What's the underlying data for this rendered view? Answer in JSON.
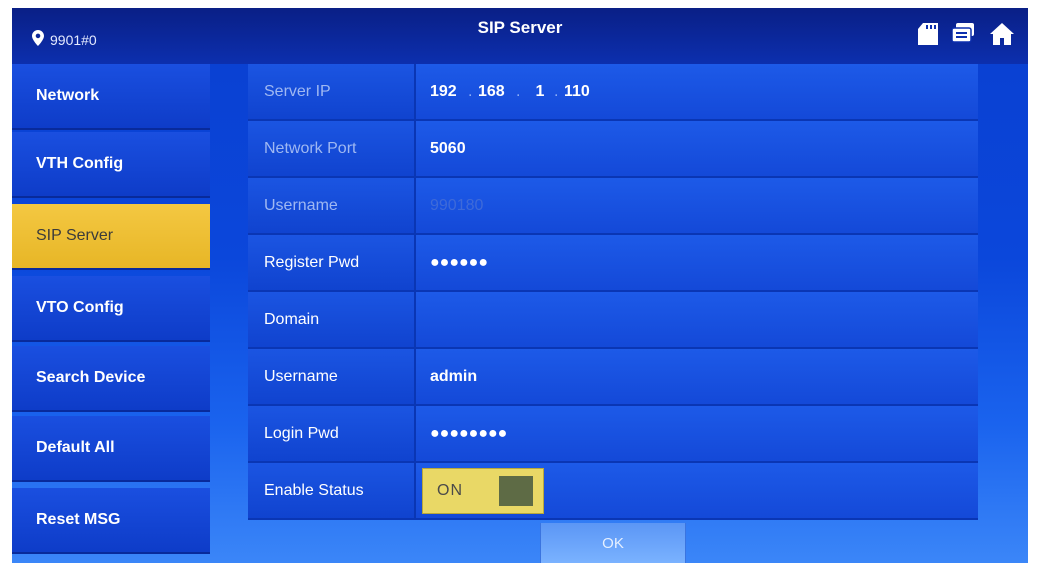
{
  "header": {
    "device_id": "9901#0",
    "title": "SIP Server"
  },
  "icons": {
    "location": "map-pin-icon",
    "sd_card": "sd-card-icon",
    "messages": "messages-icon",
    "home": "home-icon"
  },
  "sidebar": {
    "items": [
      {
        "label": "Network"
      },
      {
        "label": "VTH Config"
      },
      {
        "label": "SIP Server",
        "active": true
      },
      {
        "label": "VTO Config"
      },
      {
        "label": "Search Device"
      },
      {
        "label": "Default All"
      },
      {
        "label": "Reset MSG"
      }
    ]
  },
  "form": {
    "server_ip": {
      "label": "Server IP",
      "octets": [
        "192",
        "168",
        "1",
        "110"
      ]
    },
    "network_port": {
      "label": "Network Port",
      "value": "5060"
    },
    "username_sip": {
      "label": "Username",
      "value": "990180"
    },
    "register_pwd": {
      "label": "Register Pwd",
      "value": "●●●●●●"
    },
    "domain": {
      "label": "Domain",
      "value": ""
    },
    "username": {
      "label": "Username",
      "value": "admin"
    },
    "login_pwd": {
      "label": "Login Pwd",
      "value": "●●●●●●●●"
    },
    "enable_status": {
      "label": "Enable Status",
      "value": "ON"
    }
  },
  "ok_label": "OK",
  "colors": {
    "accent_active": "#f4c842",
    "panel_blue": "#1449d8",
    "topbar": "#0a1f86",
    "toggle": "#e9d866"
  }
}
